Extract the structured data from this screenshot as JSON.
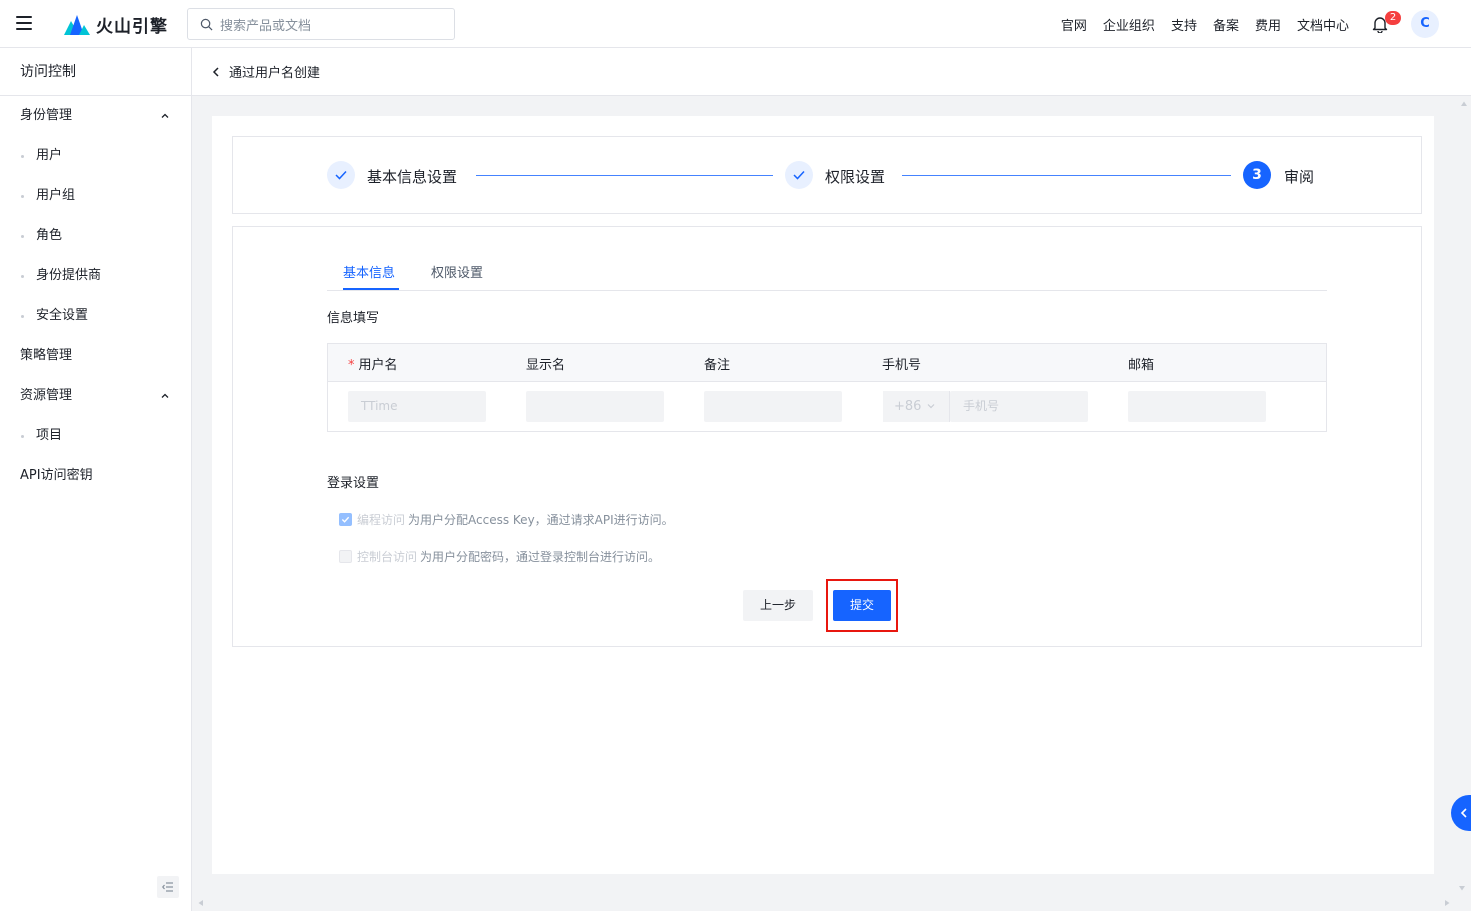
{
  "header": {
    "brand": "火山引擎",
    "search_placeholder": "搜索产品或文档",
    "nav": [
      "官网",
      "企业组织",
      "支持",
      "备案",
      "费用",
      "文档中心"
    ],
    "notification_count": "2",
    "avatar_letter": "C"
  },
  "sidebar": {
    "title": "访问控制",
    "groups": [
      {
        "label": "身份管理",
        "items": [
          "用户",
          "用户组",
          "角色",
          "身份提供商",
          "安全设置"
        ]
      },
      {
        "label": "策略管理"
      },
      {
        "label": "资源管理",
        "items": [
          "项目"
        ]
      },
      {
        "label": "API访问密钥"
      }
    ]
  },
  "page": {
    "title": "通过用户名创建",
    "steps": [
      {
        "label": "基本信息设置",
        "status": "done"
      },
      {
        "label": "权限设置",
        "status": "done"
      },
      {
        "label": "审阅",
        "number": "3",
        "status": "current"
      }
    ],
    "tabs": [
      "基本信息",
      "权限设置"
    ],
    "info_section": "信息填写",
    "table": {
      "required_mark": "*",
      "headers": [
        "用户名",
        "显示名",
        "备注",
        "手机号",
        "邮箱"
      ],
      "username_value": "TTime",
      "phone_prefix": "+86",
      "phone_placeholder": "手机号"
    },
    "login_section": "登录设置",
    "options": [
      {
        "label": "编程访问",
        "desc": "为用户分配Access Key，通过请求API进行访问。",
        "checked": true
      },
      {
        "label": "控制台访问",
        "desc": "为用户分配密码，通过登录控制台进行访问。",
        "checked": false
      }
    ],
    "buttons": {
      "prev": "上一步",
      "submit": "提交"
    }
  },
  "colors": {
    "primary": "#1664ff",
    "highlight": "#e8170f",
    "badge": "#f53f3f"
  }
}
